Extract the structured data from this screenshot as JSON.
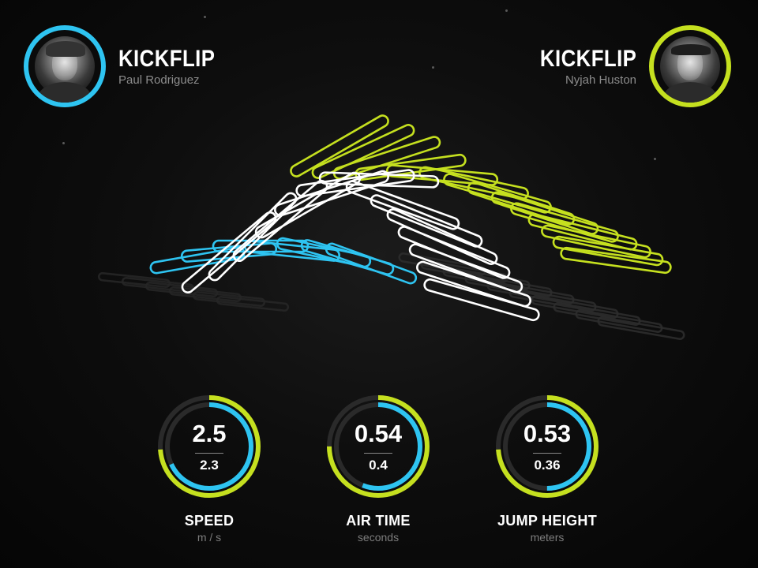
{
  "colors": {
    "blue": "#2ec4f1",
    "green": "#c5e01f",
    "white": "#ffffff",
    "track": "#2a2a2a"
  },
  "skaters": {
    "left": {
      "trick": "KICKFLIP",
      "name": "Paul Rodriguez",
      "color": "#2ec4f1",
      "avatar_icon": "skater-portrait"
    },
    "right": {
      "trick": "KICKFLIP",
      "name": "Nyjah Huston",
      "color": "#c5e01f",
      "avatar_icon": "skater-portrait"
    }
  },
  "metrics": [
    {
      "value_primary": "2.5",
      "value_secondary": "2.3",
      "label": "SPEED",
      "unit": "m / s",
      "green_fraction": 0.74,
      "blue_fraction": 0.68
    },
    {
      "value_primary": "0.54",
      "value_secondary": "0.4",
      "label": "AIR TIME",
      "unit": "seconds",
      "green_fraction": 0.75,
      "blue_fraction": 0.56
    },
    {
      "value_primary": "0.53",
      "value_secondary": "0.36",
      "label": "JUMP HEIGHT",
      "unit": "meters",
      "green_fraction": 0.74,
      "blue_fraction": 0.5
    }
  ]
}
